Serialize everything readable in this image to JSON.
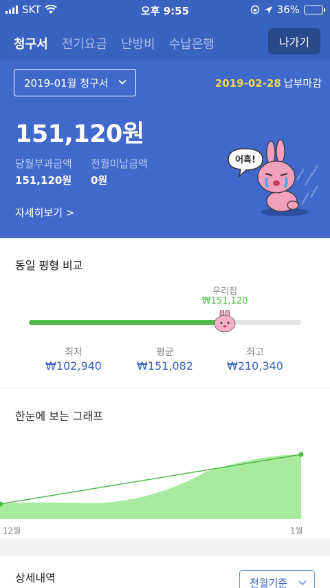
{
  "status_bar": {
    "carrier": "SKT",
    "time": "오후 9:55",
    "battery": "36%",
    "battery_level": 0.36
  },
  "tabs": [
    {
      "label": "청구서",
      "active": true
    },
    {
      "label": "전기요금",
      "active": false
    },
    {
      "label": "난방비",
      "active": false
    },
    {
      "label": "수납은행",
      "active": false
    }
  ],
  "exit_label": "나가기",
  "bill": {
    "month_select": "2019-01월 청구서",
    "due_date": "2019-02-28",
    "due_label": "납부마감",
    "total": "151,120원",
    "current_label": "당월부과금액",
    "current_value": "151,120원",
    "prev_label": "전월미납금액",
    "prev_value": "0원",
    "detail_link": "자세히보기 >"
  },
  "mascot": {
    "speech": "어흑!",
    "icon": "crying-bunny"
  },
  "compare": {
    "title": "동일 평형 비교",
    "ours_label": "우리집",
    "ours_value": "₩151,120",
    "position_fraction": 0.72,
    "min_label": "최저",
    "min_value": "₩102,940",
    "avg_label": "평균",
    "avg_value": "₩151,082",
    "max_label": "최고",
    "max_value": "₩210,340"
  },
  "graph": {
    "title": "한눈에 보는 그래프",
    "start_label": "12월",
    "end_label": "1월"
  },
  "details": {
    "title": "상세내역",
    "basis_select": "전월기준"
  },
  "colors": {
    "primary": "#3a62c1",
    "accent_green": "#4fb848",
    "due_yellow": "#f4d84b"
  }
}
